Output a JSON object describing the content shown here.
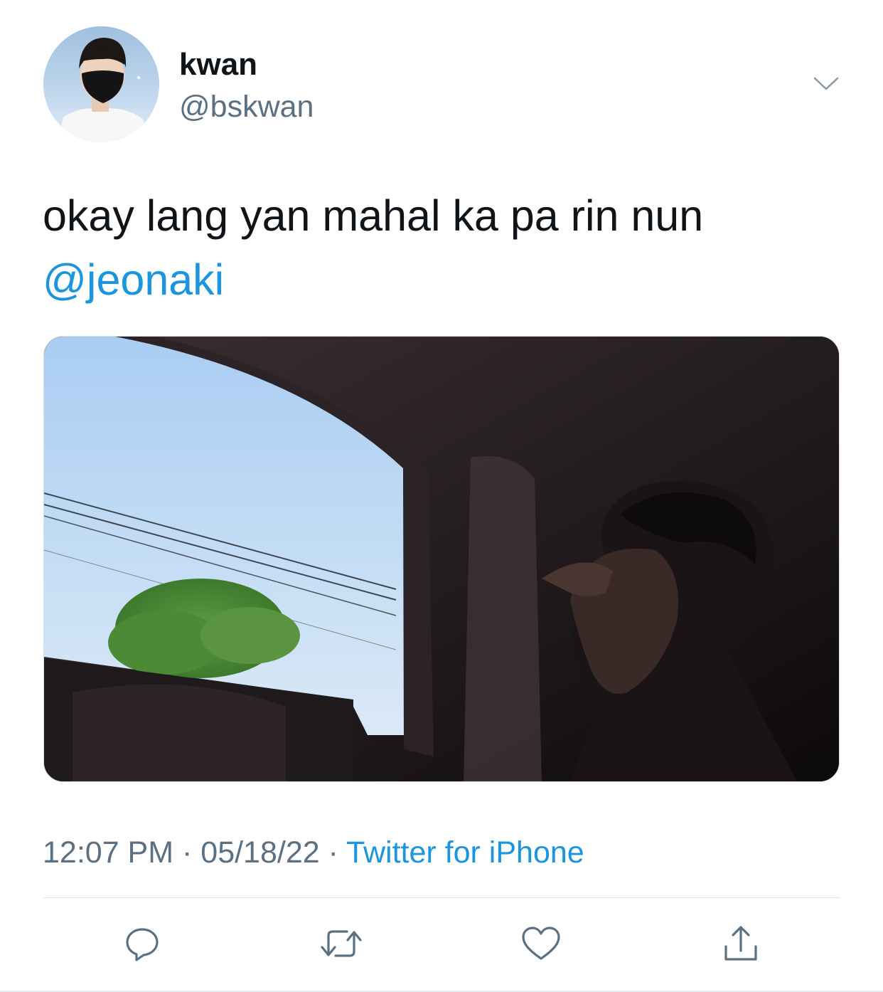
{
  "author": {
    "display_name": "kwan",
    "handle": "@bskwan",
    "avatar": "profile-avatar"
  },
  "tweet": {
    "text": "okay lang yan mahal ka pa rin nun",
    "mention": "@jeonaki"
  },
  "meta": {
    "time": "12:07 PM",
    "separator1": " · ",
    "date": "05/18/22",
    "separator2": " · ",
    "source": "Twitter for iPhone"
  },
  "icons": {
    "more": "chevron-down-icon",
    "reply": "reply-icon",
    "retweet": "retweet-icon",
    "like": "heart-icon",
    "share": "share-icon"
  },
  "colors": {
    "text": "#0f1419",
    "secondary": "#5b7083",
    "link": "#1b95e0",
    "icon": "#5b7083"
  }
}
